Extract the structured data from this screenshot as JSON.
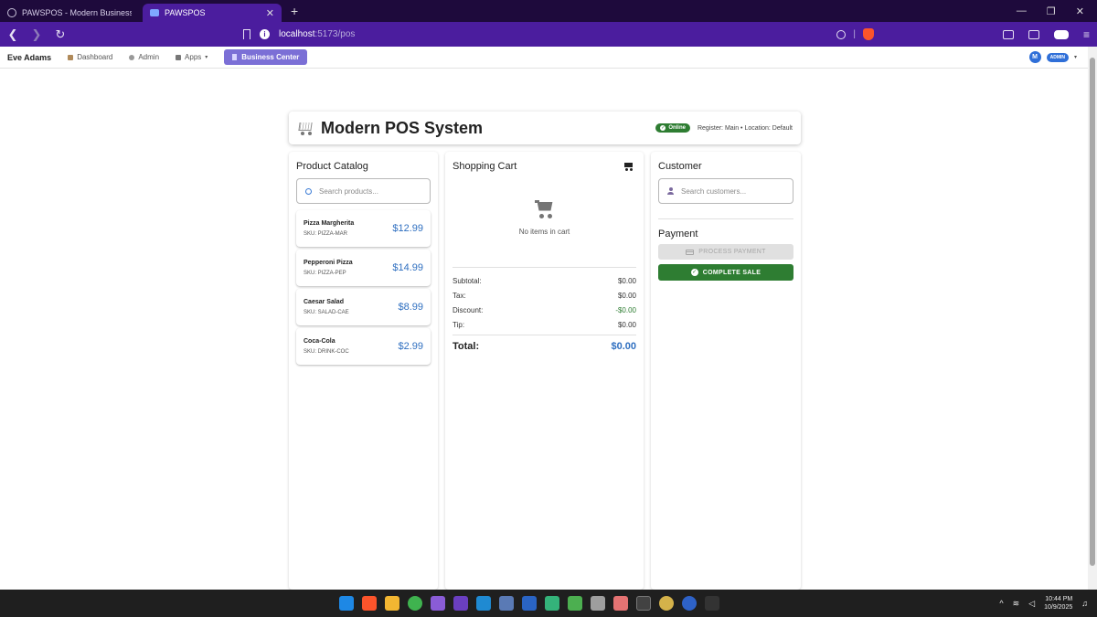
{
  "browser": {
    "tabs": [
      {
        "title": "PAWSPOS - Modern Business Platform",
        "active": false
      },
      {
        "title": "PAWSPOS",
        "active": true
      }
    ],
    "new_tab": "+",
    "url_host": "localhost",
    "url_path": ":5173/pos"
  },
  "appnav": {
    "brand": "Eve Adams",
    "links": [
      {
        "label": "Dashboard",
        "icon": "house-icon"
      },
      {
        "label": "Admin",
        "icon": "gear-icon"
      },
      {
        "label": "Apps",
        "icon": "apps-icon"
      }
    ],
    "apps_caret": "▾",
    "business_center": "Business Center",
    "avatar_initial": "M",
    "role": "ADMIN",
    "user_caret": "▾"
  },
  "pos": {
    "title": "Modern POS System",
    "status": "Online",
    "register_info": "Register: Main • Location: Default"
  },
  "catalog": {
    "title": "Product Catalog",
    "search_placeholder": "Search products...",
    "products": [
      {
        "name": "Pizza Margherita",
        "sku": "SKU: PIZZA-MAR",
        "price": "$12.99"
      },
      {
        "name": "Pepperoni Pizza",
        "sku": "SKU: PIZZA-PEP",
        "price": "$14.99"
      },
      {
        "name": "Caesar Salad",
        "sku": "SKU: SALAD-CAE",
        "price": "$8.99"
      },
      {
        "name": "Coca-Cola",
        "sku": "SKU: DRINK-COC",
        "price": "$2.99"
      }
    ]
  },
  "cart": {
    "title": "Shopping Cart",
    "empty_text": "No items in cart",
    "rows": [
      {
        "label": "Subtotal:",
        "value": "$0.00"
      },
      {
        "label": "Tax:",
        "value": "$0.00"
      },
      {
        "label": "Discount:",
        "value": "-$0.00"
      },
      {
        "label": "Tip:",
        "value": "$0.00"
      }
    ],
    "total_label": "Total:",
    "total_value": "$0.00"
  },
  "customer": {
    "title": "Customer",
    "search_placeholder": "Search customers...",
    "payment_title": "Payment",
    "process_payment": "PROCESS PAYMENT",
    "complete_sale": "COMPLETE SALE"
  },
  "taskbar": {
    "time": "10:44 PM",
    "date": "10/9/2025"
  },
  "colors": {
    "tabbar": "#1e0a3c",
    "addressbar": "#4b1d9e",
    "accent_blue": "#2f6fc0",
    "success_green": "#2e7d32",
    "business_center": "#7b6fd6"
  }
}
